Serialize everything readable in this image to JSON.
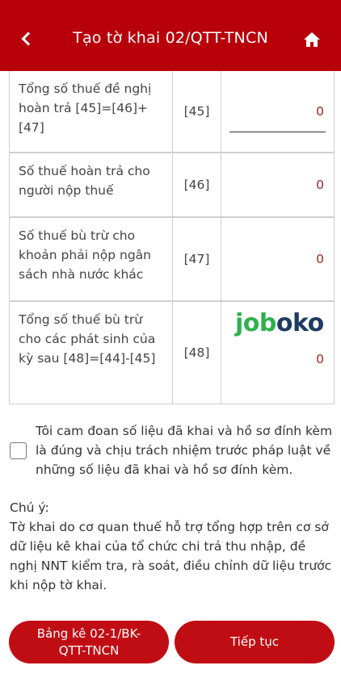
{
  "header": {
    "title": "Tạo tờ khai 02/QTT-TNCN",
    "back_icon": "chevron-left-icon",
    "home_icon": "home-icon",
    "background": "#b8000a"
  },
  "table": {
    "rows": [
      {
        "label": "Tổng số thuế đề nghị hoàn trả [45]=[46]+[47]",
        "code": "[45]",
        "value": "0"
      },
      {
        "label": "Số thuế hoàn trả cho người nộp thuế",
        "code": "[46]",
        "value": "0"
      },
      {
        "label": "Số thuế bù trừ cho khoản phải nộp ngân sách nhà nước khác",
        "code": "[47]",
        "value": "0"
      },
      {
        "label": "Tổng số thuế bù trừ cho các phát sinh của kỳ sau [48]=[44]-[45]",
        "code": "[48]",
        "value": "0"
      }
    ]
  },
  "watermark": {
    "part1": "job",
    "part2": "oko"
  },
  "commitment": {
    "text": "Tôi cam đoan số liệu đã khai và hồ sơ đính kèm là đúng và chịu trách nhiệm trước pháp luật về những số liệu đã khai và hồ sơ đính kèm.",
    "checked": false
  },
  "note": {
    "heading": "Chú ý:",
    "text": "Tờ khai do cơ quan thuế hỗ trợ tổng hợp trên cơ sở dữ liệu kê khai của tổ chức chi trả thu nhập, đề nghị NNT kiểm tra, rà soát, điều chỉnh dữ liệu trước khi nộp tờ khai."
  },
  "buttons": {
    "left_label": "Bảng kê 02-1/BK-QTT-TNCN",
    "right_label": "Tiếp tục",
    "color": "#c00d14"
  }
}
